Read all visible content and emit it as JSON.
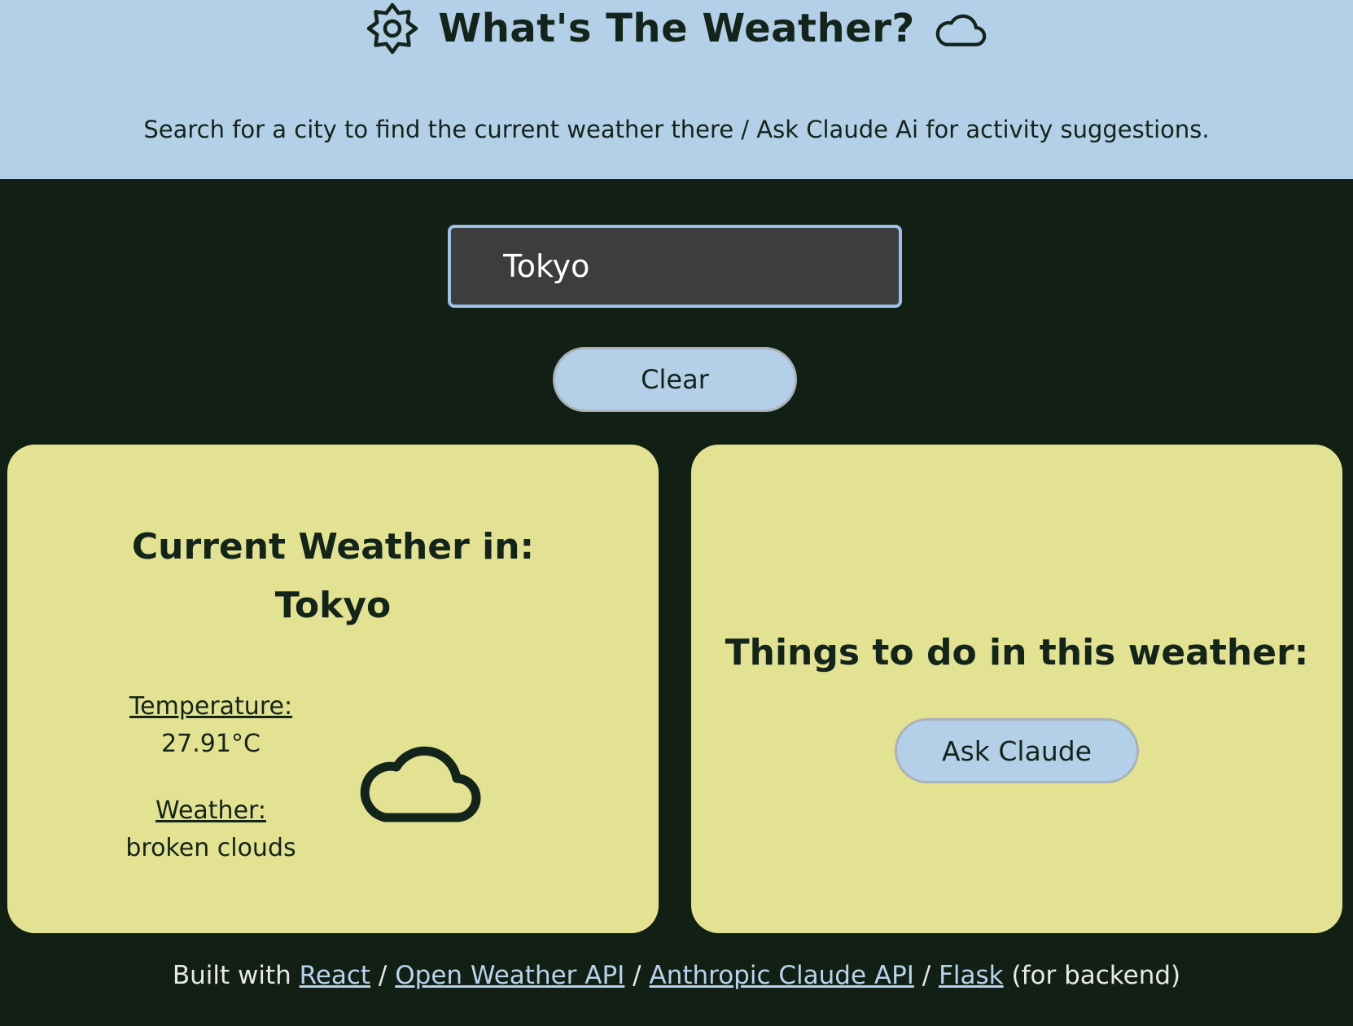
{
  "header": {
    "title": "What's The Weather?",
    "subtitle": "Search for a city to find the current weather there / Ask Claude Ai for activity suggestions.",
    "left_icon": "sun-gear-icon",
    "right_icon": "cloud-icon"
  },
  "search": {
    "value": "Tokyo"
  },
  "clear_button": {
    "label": "Clear"
  },
  "weather_card": {
    "heading_line1": "Current Weather in:",
    "city": "Tokyo",
    "temperature_label": "Temperature:",
    "temperature_value": "27.91°C",
    "weather_label": "Weather:",
    "weather_value": "broken clouds",
    "icon": "cloud-icon"
  },
  "activity_card": {
    "heading": "Things to do in this weather:",
    "button_label": "Ask Claude"
  },
  "footer": {
    "prefix": "Built with",
    "sep1": "/",
    "sep2": "/",
    "sep3": "/",
    "links": [
      "React",
      "Open Weather API",
      "Anthropic Claude API",
      "Flask"
    ],
    "suffix": "(for backend)"
  },
  "colors": {
    "header_bg": "#b3d0e8",
    "page_bg": "#111f14",
    "card_bg": "#e3e293",
    "input_bg": "#3d3d3d",
    "input_border": "#9fbee8",
    "button_bg": "#b3d0e8",
    "text_dark": "#13241a",
    "link": "#b8d4ec"
  }
}
